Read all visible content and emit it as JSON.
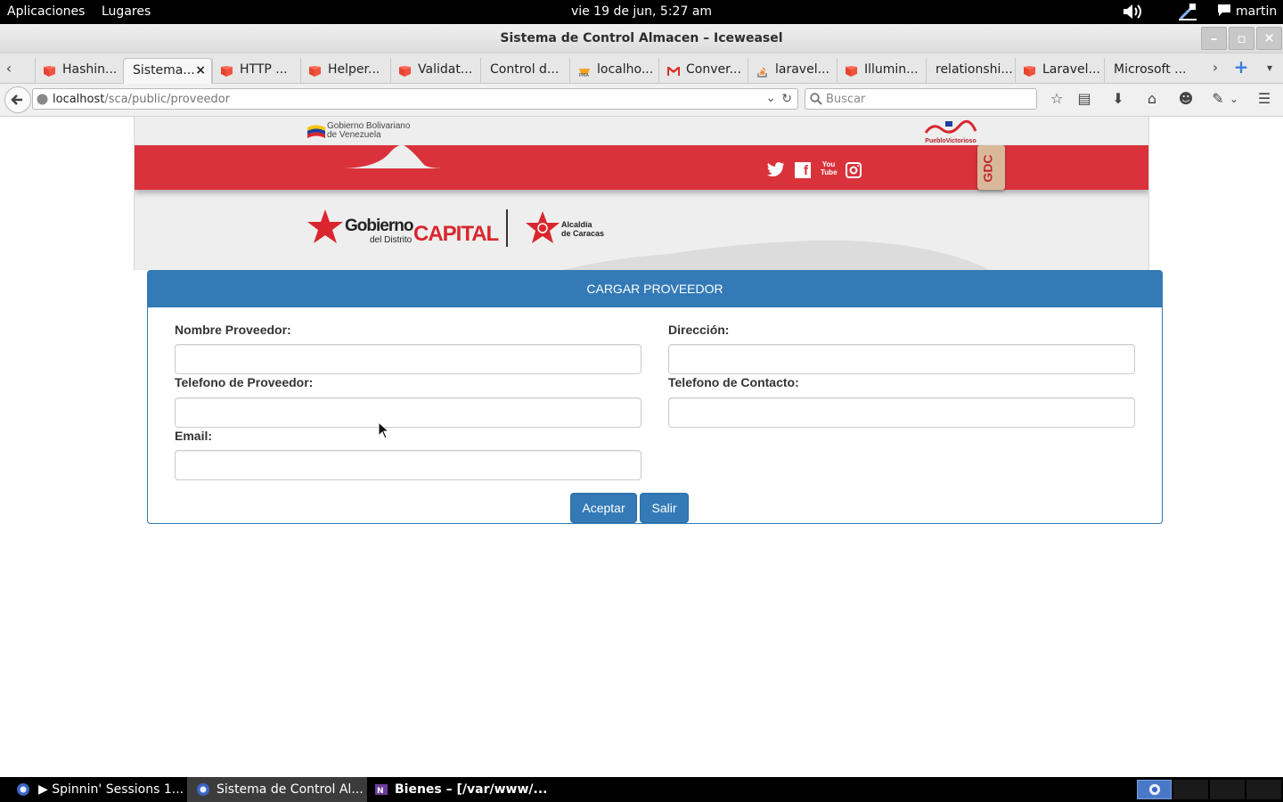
{
  "system": {
    "menu_apps": "Aplicaciones",
    "menu_places": "Lugares",
    "clock": "vie 19 de jun,  5:27 am",
    "user": "martin",
    "icons": [
      "volume-icon",
      "accessibility-icon",
      "chat-icon"
    ]
  },
  "window": {
    "title": "Sistema de Control Almacen – Iceweasel",
    "buttons": [
      "minimize",
      "maximize",
      "close"
    ]
  },
  "tabs": [
    {
      "label": "Hashin...",
      "icon": "laravel"
    },
    {
      "label": "Sistema...",
      "icon": "none",
      "active": true
    },
    {
      "label": "HTTP ...",
      "icon": "laravel"
    },
    {
      "label": "Helper...",
      "icon": "laravel"
    },
    {
      "label": "Validat...",
      "icon": "laravel"
    },
    {
      "label": "Control d...",
      "icon": "none"
    },
    {
      "label": "localho...",
      "icon": "pma"
    },
    {
      "label": "Conver...",
      "icon": "gmail"
    },
    {
      "label": "laravel...",
      "icon": "stackoverflow"
    },
    {
      "label": "Illumin...",
      "icon": "laravel"
    },
    {
      "label": "relationshi...",
      "icon": "none"
    },
    {
      "label": "Laravel...",
      "icon": "laravel"
    },
    {
      "label": "Microsoft ...",
      "icon": "none"
    }
  ],
  "tab_close": "×",
  "nav": {
    "url_host": "localhost",
    "url_path": "/sca/public/proveedor",
    "search_placeholder": "Buscar"
  },
  "banner": {
    "gov_top_line1": "Gobierno Bolivariano",
    "gov_top_line2": "de Venezuela",
    "right_logo_text": "PuebloVictorioso",
    "gdc": "GDC",
    "gobierno": "Gobierno",
    "del_distrito": "del Distrito",
    "capital": "CAPITAL",
    "alcaldia_line1": "Alcaldía",
    "alcaldia_line2": "de Caracas",
    "social": [
      "twitter-icon",
      "facebook-icon",
      "youtube-icon",
      "instagram-icon"
    ],
    "youtube_text": "You Tube"
  },
  "form": {
    "heading": "CARGAR PROVEEDOR",
    "fields": [
      {
        "label": "Nombre Proveedor:",
        "value": ""
      },
      {
        "label": "Dirección:",
        "value": ""
      },
      {
        "label": "Telefono de Proveedor:",
        "value": ""
      },
      {
        "label": "Telefono de Contacto:",
        "value": ""
      },
      {
        "label": "Email:",
        "value": ""
      }
    ],
    "accept": "Aceptar",
    "exit": "Salir"
  },
  "taskbar": [
    {
      "label": "▶ Spinnin' Sessions 1...",
      "active": false
    },
    {
      "label": "Sistema de Control Al...",
      "active": true
    },
    {
      "label": "Bienes – [/var/www/...",
      "active": false,
      "bold": true
    }
  ],
  "colors": {
    "primary": "#337ab7",
    "banner_red": "#d9323b",
    "star_red": "#d9262e"
  }
}
